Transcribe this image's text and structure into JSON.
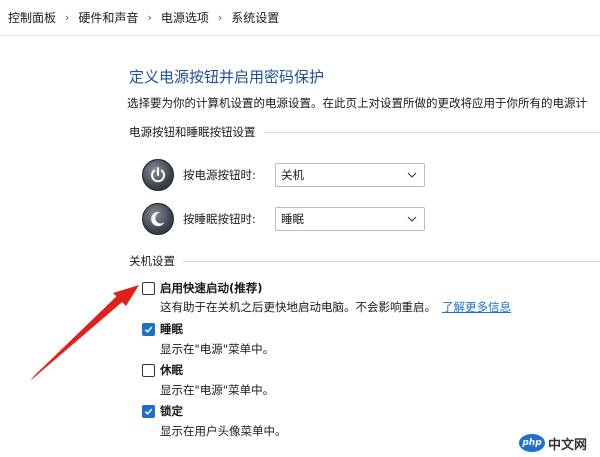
{
  "breadcrumb": [
    "控制面板",
    "硬件和声音",
    "电源选项",
    "系统设置"
  ],
  "page": {
    "title": "定义电源按钮并启用密码保护",
    "description": "选择要为你的计算机设置的电源设置。在此页上对设置所做的更改将应用于你所有的电源计"
  },
  "power_section": {
    "header": "电源按钮和睡眠按钮设置",
    "power_button_label": "按电源按钮时:",
    "power_button_value": "关机",
    "sleep_button_label": "按睡眠按钮时:",
    "sleep_button_value": "睡眠"
  },
  "shutdown_section": {
    "header": "关机设置",
    "items": [
      {
        "label": "启用快速启动(推荐)",
        "checked": false,
        "desc": "这有助于在关机之后更快地启动电脑。不会影响重启。",
        "link": "了解更多信息"
      },
      {
        "label": "睡眠",
        "checked": true,
        "desc": "显示在\"电源\"菜单中。"
      },
      {
        "label": "休眠",
        "checked": false,
        "desc": "显示在\"电源\"菜单中。"
      },
      {
        "label": "锁定",
        "checked": true,
        "desc": "显示在用户头像菜单中。"
      }
    ]
  },
  "watermark": {
    "badge": "php",
    "text": "中文网"
  },
  "colors": {
    "accent": "#1f6fc5",
    "title": "#1c4f9c",
    "annotation_arrow": "#e0201b"
  }
}
